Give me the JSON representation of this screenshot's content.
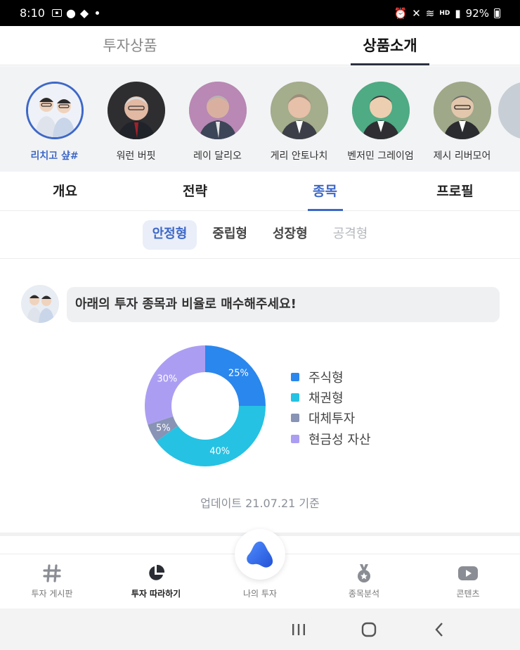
{
  "status_bar": {
    "time": "8:10",
    "battery": "92%",
    "network": "HD"
  },
  "top_tabs": [
    {
      "label": "투자상품",
      "active": false
    },
    {
      "label": "상품소개",
      "active": true
    }
  ],
  "investors": [
    {
      "name": "리치고 샾#",
      "active": true
    },
    {
      "name": "워런 버핏",
      "active": false
    },
    {
      "name": "레이 달리오",
      "active": false
    },
    {
      "name": "게리 안토나치",
      "active": false
    },
    {
      "name": "벤저민 그레이엄",
      "active": false
    },
    {
      "name": "제시 리버모어",
      "active": false
    }
  ],
  "sub_tabs": [
    {
      "label": "개요"
    },
    {
      "label": "전략"
    },
    {
      "label": "종목",
      "active": true
    },
    {
      "label": "프로필"
    }
  ],
  "types": [
    {
      "label": "안정형",
      "state": "active"
    },
    {
      "label": "중립형",
      "state": "normal"
    },
    {
      "label": "성장형",
      "state": "normal"
    },
    {
      "label": "공격형",
      "state": "disabled"
    }
  ],
  "message": "아래의 투자 종목과 비율로 매수해주세요!",
  "chart_data": {
    "type": "pie",
    "donut": true,
    "legend_position": "right",
    "slices": [
      {
        "label": "주식형",
        "value": 25,
        "display": "25%",
        "color": "#2a87ee"
      },
      {
        "label": "채권형",
        "value": 40,
        "display": "40%",
        "color": "#25c2e3"
      },
      {
        "label": "대체투자",
        "value": 5,
        "display": "5%",
        "color": "#8893b5"
      },
      {
        "label": "현금성 자산",
        "value": 30,
        "display": "30%",
        "color": "#ab9ef2"
      }
    ]
  },
  "update_text": "업데이트 21.07.21 기준",
  "bottom_nav": [
    {
      "label": "투자 게시판",
      "icon": "hash-icon"
    },
    {
      "label": "투자 따라하기",
      "icon": "pie-chart-icon",
      "active": true
    },
    {
      "label": "나의 투자",
      "icon": "my-invest-icon"
    },
    {
      "label": "종목분석",
      "icon": "medal-icon"
    },
    {
      "label": "콘텐츠",
      "icon": "video-play-icon"
    }
  ],
  "colors": {
    "accent": "#3e68c8"
  }
}
